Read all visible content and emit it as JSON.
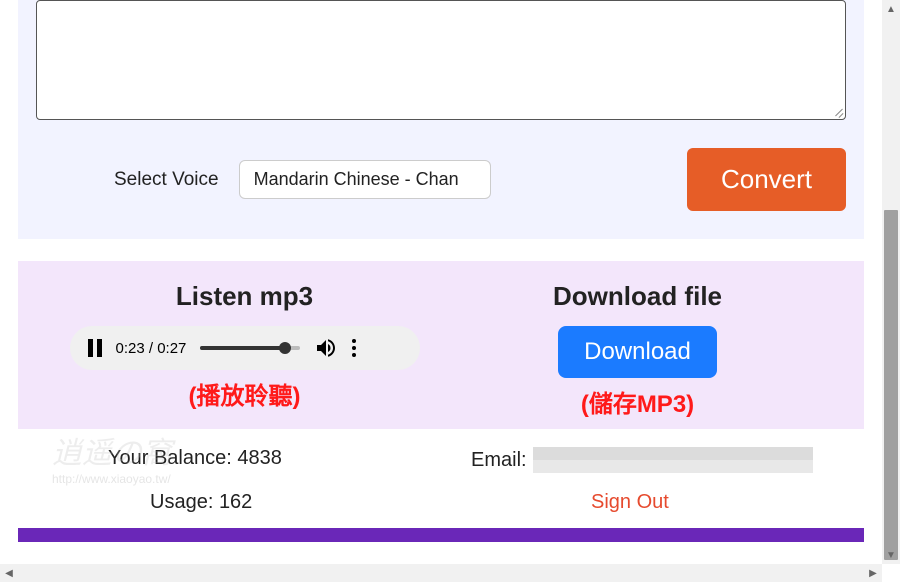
{
  "top": {
    "select_voice_label": "Select Voice",
    "selected_voice": "Mandarin Chinese - Chan",
    "convert_label": "Convert"
  },
  "mid": {
    "listen_title": "Listen mp3",
    "download_title": "Download file",
    "audio": {
      "time_text": "0:23 / 0:27",
      "progress_pct": 85
    },
    "download_label": "Download",
    "annot_listen": "(播放聆聽)",
    "annot_save": "(儲存MP3)"
  },
  "bottom": {
    "balance_label": "Your Balance:",
    "balance_value": "4838",
    "usage_label": "Usage:",
    "usage_value": "162",
    "email_label": "Email:",
    "signout_label": "Sign Out"
  },
  "watermark": {
    "line1": "逍遥の窩",
    "line2": "http://www.xiaoyao.tw/"
  }
}
